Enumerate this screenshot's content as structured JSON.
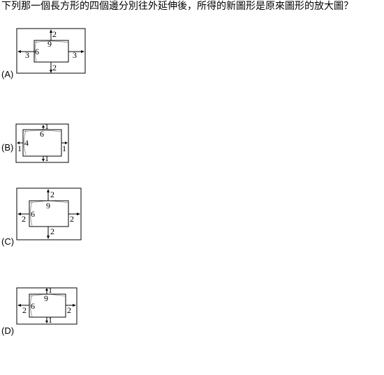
{
  "question": "下列那一個長方形的四個邊分別往外延伸後，所得的新圖形是原來圖形的放大圖？",
  "options": [
    {
      "label": "(A)",
      "inner_width": "9",
      "inner_height": "6",
      "top": "2",
      "bottom": "2",
      "left": "3",
      "right": "3"
    },
    {
      "label": "(B)",
      "inner_width": "6",
      "inner_height": "4",
      "top": "1",
      "bottom": "1",
      "left": "1",
      "right": "1"
    },
    {
      "label": "(C)",
      "inner_width": "9",
      "inner_height": "6",
      "top": "2",
      "bottom": "2",
      "left": "2",
      "right": "2"
    },
    {
      "label": "(D)",
      "inner_width": "9",
      "inner_height": "6",
      "top": "1",
      "bottom": "1",
      "left": "2",
      "right": "2"
    }
  ]
}
